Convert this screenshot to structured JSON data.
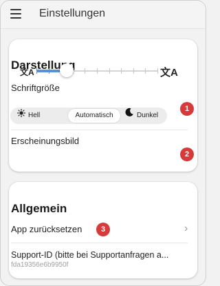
{
  "appbar": {
    "title": "Einstellungen",
    "menu_icon": "hamburger-menu-icon"
  },
  "display_section": {
    "title": "Darstellung",
    "font_size": {
      "label": "Schriftgröße",
      "small_icon": "translate-small-icon",
      "large_icon": "translate-large-icon",
      "steps": 10,
      "level_fraction": 0.25,
      "badge": "1"
    },
    "appearance": {
      "label": "Erscheinungsbild",
      "options": [
        {
          "label": "Hell",
          "icon": "sun-icon"
        },
        {
          "label": "Automatisch",
          "icon": ""
        },
        {
          "label": "Dunkel",
          "icon": "moon-icon"
        }
      ],
      "selected": "Automatisch",
      "badge": "2"
    }
  },
  "general_section": {
    "title": "Allgemein",
    "reset": {
      "label": "App zurücksetzen",
      "badge": "3",
      "chevron_icon": "chevron-right-icon"
    },
    "support": {
      "label": "Support-ID (bitte bei Supportanfragen a...",
      "id": "fda19356e6b9950f"
    }
  },
  "colors": {
    "accent": "#5b8fd6",
    "badge": "#d63a3a",
    "card": "#ffffff",
    "background": "#f2f2f2"
  }
}
